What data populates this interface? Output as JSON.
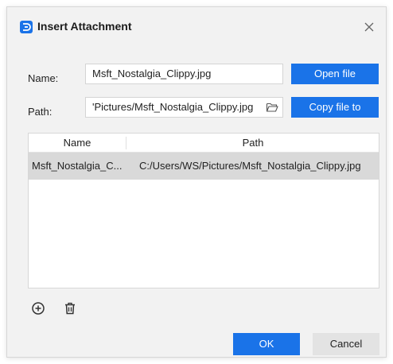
{
  "dialog": {
    "title": "Insert Attachment",
    "app_icon": "attachment-app-icon",
    "close_icon": "close-icon"
  },
  "form": {
    "name_label": "Name:",
    "name_value": "Msft_Nostalgia_Clippy.jpg",
    "path_label": "Path:",
    "path_value": "'Pictures/Msft_Nostalgia_Clippy.jpg",
    "browse_icon": "folder-open-icon",
    "open_file_label": "Open file",
    "copy_file_label": "Copy file to"
  },
  "table": {
    "columns": [
      "Name",
      "Path"
    ],
    "rows": [
      {
        "name": "Msft_Nostalgia_C...",
        "path": "C:/Users/WS/Pictures/Msft_Nostalgia_Clippy.jpg",
        "selected": true
      }
    ]
  },
  "toolbar": {
    "add_icon": "add-circle-icon",
    "delete_icon": "trash-icon"
  },
  "footer": {
    "ok_label": "OK",
    "cancel_label": "Cancel"
  },
  "colors": {
    "accent": "#1a73e8",
    "dialog_bg": "#f2f2f2",
    "selected_row": "#d9d9d9"
  }
}
